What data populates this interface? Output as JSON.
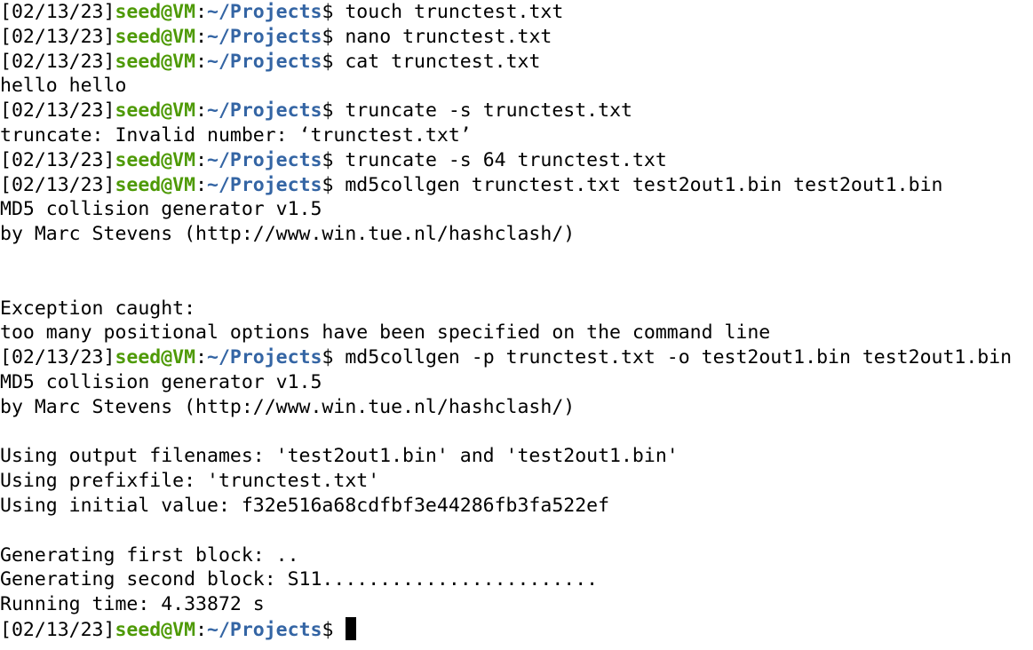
{
  "prompt": {
    "date": "[02/13/23]",
    "user": "seed@VM",
    "colon": ":",
    "path": "~/Projects",
    "dollar": "$ "
  },
  "colors": {
    "user": "#4e9a06",
    "path": "#3465a4",
    "text": "#000000",
    "background": "#ffffff"
  },
  "lines": [
    {
      "type": "cmd",
      "text": "touch trunctest.txt"
    },
    {
      "type": "cmd",
      "text": "nano trunctest.txt"
    },
    {
      "type": "cmd",
      "text": "cat trunctest.txt"
    },
    {
      "type": "out",
      "text": "hello hello"
    },
    {
      "type": "cmd",
      "text": "truncate -s trunctest.txt"
    },
    {
      "type": "out",
      "text": "truncate: Invalid number: ‘trunctest.txt’"
    },
    {
      "type": "cmd",
      "text": "truncate -s 64 trunctest.txt"
    },
    {
      "type": "cmd",
      "text": "md5collgen trunctest.txt test2out1.bin test2out1.bin"
    },
    {
      "type": "out",
      "text": "MD5 collision generator v1.5"
    },
    {
      "type": "out",
      "text": "by Marc Stevens (http://www.win.tue.nl/hashclash/)"
    },
    {
      "type": "out",
      "text": ""
    },
    {
      "type": "out",
      "text": ""
    },
    {
      "type": "out",
      "text": "Exception caught:"
    },
    {
      "type": "out",
      "text": "too many positional options have been specified on the command line"
    },
    {
      "type": "cmd",
      "text": "md5collgen -p trunctest.txt -o test2out1.bin test2out1.bin"
    },
    {
      "type": "out",
      "text": "MD5 collision generator v1.5"
    },
    {
      "type": "out",
      "text": "by Marc Stevens (http://www.win.tue.nl/hashclash/)"
    },
    {
      "type": "out",
      "text": ""
    },
    {
      "type": "out",
      "text": "Using output filenames: 'test2out1.bin' and 'test2out1.bin'"
    },
    {
      "type": "out",
      "text": "Using prefixfile: 'trunctest.txt'"
    },
    {
      "type": "out",
      "text": "Using initial value: f32e516a68cdfbf3e44286fb3fa522ef"
    },
    {
      "type": "out",
      "text": ""
    },
    {
      "type": "out",
      "text": "Generating first block: .."
    },
    {
      "type": "out",
      "text": "Generating second block: S11........................"
    },
    {
      "type": "out",
      "text": "Running time: 4.33872 s"
    },
    {
      "type": "prompt",
      "text": ""
    }
  ],
  "cursor_icon": "block-cursor-icon"
}
